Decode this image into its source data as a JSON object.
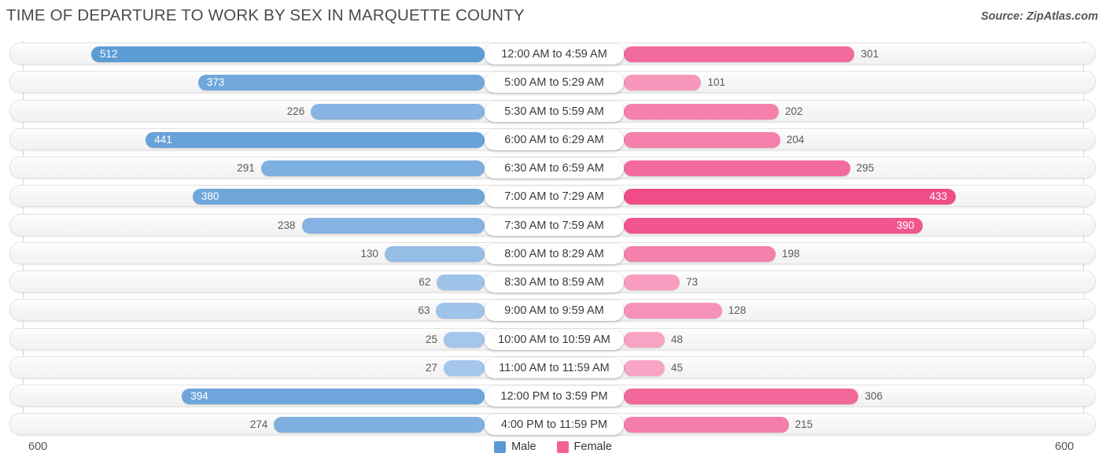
{
  "header": {
    "title": "TIME OF DEPARTURE TO WORK BY SEX IN MARQUETTE COUNTY",
    "source": "Source: ZipAtlas.com"
  },
  "axis": {
    "left_max": "600",
    "right_max": "600"
  },
  "legend": {
    "items": [
      {
        "label": "Male",
        "color": "#5b9bd5"
      },
      {
        "label": "Female",
        "color": "#f2628f"
      }
    ]
  },
  "chart_data": {
    "type": "bar",
    "orientation": "horizontal-diverging",
    "title": "TIME OF DEPARTURE TO WORK BY SEX IN MARQUETTE COUNTY",
    "xlabel": "",
    "ylabel": "",
    "xlim": [
      600,
      600
    ],
    "grid": true,
    "legend_position": "bottom-center",
    "categories": [
      "12:00 AM to 4:59 AM",
      "5:00 AM to 5:29 AM",
      "5:30 AM to 5:59 AM",
      "6:00 AM to 6:29 AM",
      "6:30 AM to 6:59 AM",
      "7:00 AM to 7:29 AM",
      "7:30 AM to 7:59 AM",
      "8:00 AM to 8:29 AM",
      "8:30 AM to 8:59 AM",
      "9:00 AM to 9:59 AM",
      "10:00 AM to 10:59 AM",
      "11:00 AM to 11:59 AM",
      "12:00 PM to 3:59 PM",
      "4:00 PM to 11:59 PM"
    ],
    "series": [
      {
        "name": "Male",
        "side": "left",
        "values": [
          512,
          373,
          226,
          441,
          291,
          380,
          238,
          130,
          62,
          63,
          25,
          27,
          394,
          274
        ]
      },
      {
        "name": "Female",
        "side": "right",
        "values": [
          301,
          101,
          202,
          204,
          295,
          433,
          390,
          198,
          73,
          128,
          48,
          45,
          306,
          215
        ]
      }
    ]
  }
}
